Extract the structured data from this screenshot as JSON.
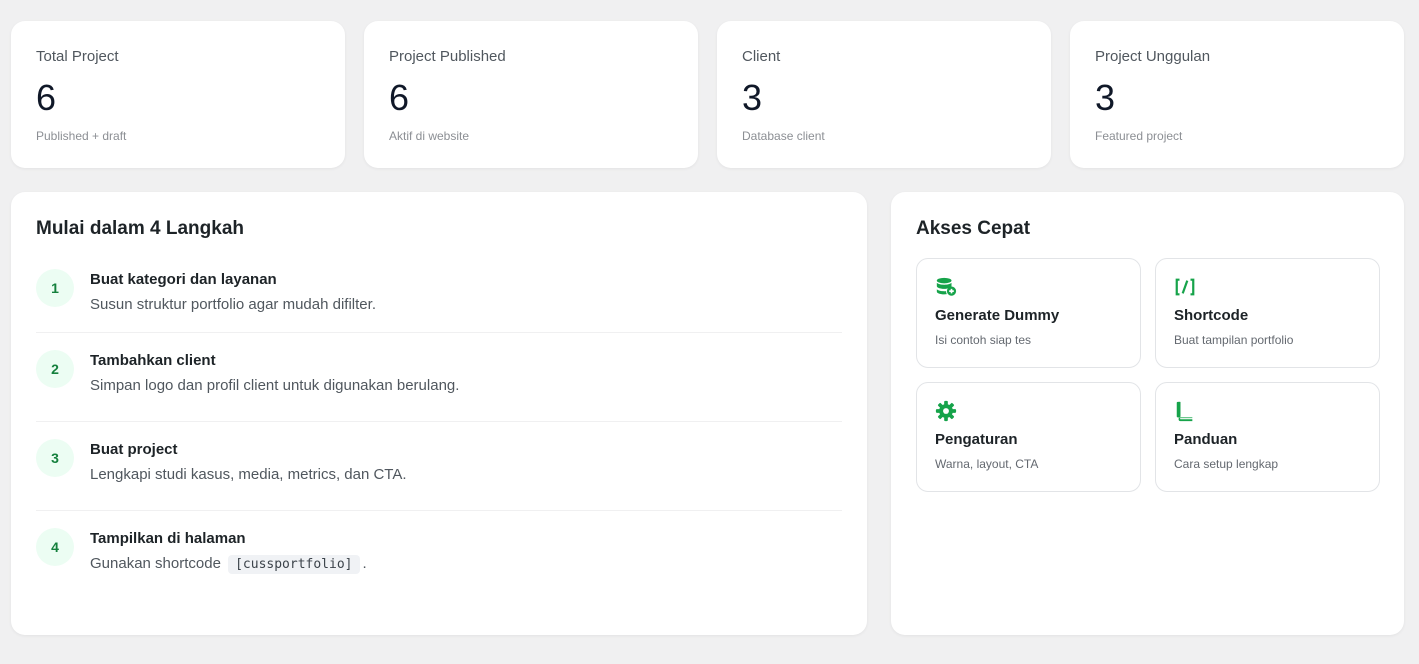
{
  "stats": [
    {
      "label": "Total Project",
      "value": "6",
      "hint": "Published + draft"
    },
    {
      "label": "Project Published",
      "value": "6",
      "hint": "Aktif di website"
    },
    {
      "label": "Client",
      "value": "3",
      "hint": "Database client"
    },
    {
      "label": "Project Unggulan",
      "value": "3",
      "hint": "Featured project"
    }
  ],
  "steps": {
    "title": "Mulai dalam 4 Langkah",
    "items": [
      {
        "num": "1",
        "title": "Buat kategori dan layanan",
        "desc": "Susun struktur portfolio agar mudah difilter."
      },
      {
        "num": "2",
        "title": "Tambahkan client",
        "desc": "Simpan logo dan profil client untuk digunakan berulang."
      },
      {
        "num": "3",
        "title": "Buat project",
        "desc": "Lengkapi studi kasus, media, metrics, dan CTA."
      },
      {
        "num": "4",
        "title": "Tampilkan di halaman",
        "desc_prefix": "Gunakan shortcode",
        "code": "[cussportfolio]",
        "desc_suffix": "."
      }
    ]
  },
  "quick": {
    "title": "Akses Cepat",
    "accent": "#16a34a",
    "items": [
      {
        "icon": "database-plus-icon",
        "title": "Generate Dummy",
        "desc": "Isi contoh siap tes"
      },
      {
        "icon": "shortcode-icon",
        "title": "Shortcode",
        "desc": "Buat tampilan portfolio"
      },
      {
        "icon": "gear-icon",
        "title": "Pengaturan",
        "desc": "Warna, layout, CTA"
      },
      {
        "icon": "book-icon",
        "title": "Panduan",
        "desc": "Cara setup lengkap"
      }
    ]
  }
}
